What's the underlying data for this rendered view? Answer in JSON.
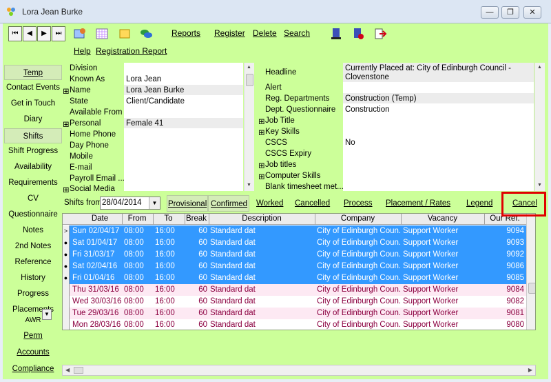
{
  "window": {
    "title": "Lora Jean Burke",
    "min": "—",
    "restore": "❐",
    "close": "✕"
  },
  "toolbar": {
    "nav": [
      "⏮",
      "◀",
      "▶",
      "⏭"
    ],
    "links": [
      "Reports",
      "Register",
      "Delete",
      "Search",
      "Help",
      "Registration Report"
    ]
  },
  "sidebar": {
    "items": [
      "Temp",
      "Contact Events",
      "Get in Touch",
      "Diary",
      "Shifts",
      "Shift Progress",
      "Availability",
      "Requirements",
      "CV",
      "Questionnaire",
      "Notes",
      "2nd Notes",
      "Reference",
      "History",
      "Progress",
      "Placements",
      "AWR",
      "Perm",
      "Accounts",
      "Compliance"
    ]
  },
  "left_panel": {
    "labels": [
      "Division",
      "Known As",
      "Name",
      "State",
      "Available From",
      "Personal",
      "Home Phone",
      "Day Phone",
      "Mobile",
      "E-mail",
      "Payroll Email ...",
      "Social Media"
    ],
    "values": [
      "",
      "Lora Jean",
      "Lora Jean Burke",
      "Client/Candidate",
      "",
      "Female 41",
      "",
      "",
      "",
      "",
      "",
      ""
    ]
  },
  "right_panel": {
    "labels": [
      "Headline",
      "Alert",
      "Reg. Departments",
      "Dept. Questionnaire",
      "Job Title",
      "Key Skills",
      "CSCS",
      "CSCS Expiry",
      "Job titles",
      "Computer Skills",
      "Blank timesheet met..."
    ],
    "headline_value": "Currently Placed at: City of Edinburgh Council - Clovenstone",
    "values": [
      "",
      "Construction (Temp)",
      "Construction",
      "",
      "",
      "No",
      "",
      "",
      "",
      ""
    ]
  },
  "filter": {
    "label": "Shifts from",
    "date": "28/04/2014",
    "links": [
      "Provisional",
      "Confirmed",
      "Worked",
      "Cancelled",
      "Process",
      "Placement / Rates",
      "Legend",
      "Cancel"
    ]
  },
  "grid": {
    "columns": [
      "Date",
      "From",
      "To",
      "Break",
      "Description",
      "Company",
      "Vacancy",
      "Our Ref."
    ],
    "rows": [
      [
        "Sun 02/04/17",
        "08:00",
        "16:00",
        "60",
        "Standard dat",
        "City of Edinburgh Coun...",
        "Support Worker",
        "9094"
      ],
      [
        "Sat 01/04/17",
        "08:00",
        "16:00",
        "60",
        "Standard dat",
        "City of Edinburgh Coun...",
        "Support Worker",
        "9093"
      ],
      [
        "Fri 31/03/17",
        "08:00",
        "16:00",
        "60",
        "Standard dat",
        "City of Edinburgh Coun...",
        "Support Worker",
        "9092"
      ],
      [
        "Sat 02/04/16",
        "08:00",
        "16:00",
        "60",
        "Standard dat",
        "City of Edinburgh Coun...",
        "Support Worker",
        "9086"
      ],
      [
        "Fri 01/04/16",
        "08:00",
        "16:00",
        "60",
        "Standard dat",
        "City of Edinburgh Coun...",
        "Support Worker",
        "9085"
      ],
      [
        "Thu 31/03/16",
        "08:00",
        "16:00",
        "60",
        "Standard dat",
        "City of Edinburgh Coun...",
        "Support Worker",
        "9084"
      ],
      [
        "Wed 30/03/16",
        "08:00",
        "16:00",
        "60",
        "Standard dat",
        "City of Edinburgh Coun...",
        "Support Worker",
        "9082"
      ],
      [
        "Tue 29/03/16",
        "08:00",
        "16:00",
        "60",
        "Standard dat",
        "City of Edinburgh Coun...",
        "Support Worker",
        "9081"
      ],
      [
        "Mon 28/03/16",
        "08:00",
        "16:00",
        "60",
        "Standard dat",
        "City of Edinburgh Coun...",
        "Support Worker",
        "9080"
      ]
    ],
    "row_markers": [
      ">",
      "●",
      "●",
      "●",
      "●",
      "",
      "",
      "",
      ""
    ]
  },
  "colors": {
    "background_green": "#ccff99",
    "selection": "#3399ff",
    "highlight_box": "#e00000"
  }
}
